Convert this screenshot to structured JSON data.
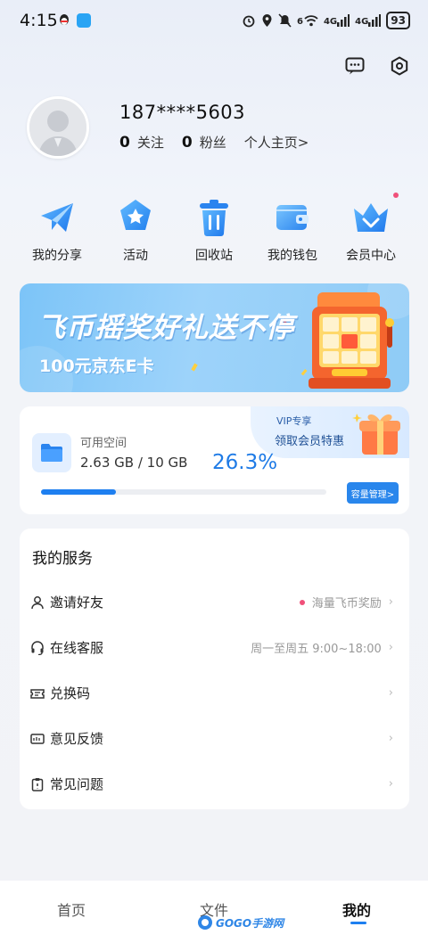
{
  "status_bar": {
    "time": "4:15",
    "signal_1": "4G",
    "signal_2": "4G",
    "wifi_badge": "6",
    "battery": "93"
  },
  "profile": {
    "phone": "187****5603",
    "following_count": "0",
    "following_label": "关注",
    "followers_count": "0",
    "followers_label": "粉丝",
    "home_link": "个人主页>"
  },
  "quick_actions": [
    {
      "label": "我的分享",
      "icon": "paper-plane-icon"
    },
    {
      "label": "活动",
      "icon": "star-badge-icon"
    },
    {
      "label": "回收站",
      "icon": "trash-icon"
    },
    {
      "label": "我的钱包",
      "icon": "wallet-icon"
    },
    {
      "label": "会员中心",
      "icon": "crown-icon"
    }
  ],
  "banner": {
    "title": "飞币摇奖好礼送不停",
    "subtitle": "100元京东E卡"
  },
  "storage": {
    "label": "可用空间",
    "usage": "2.63 GB / 10 GB",
    "percent_text": "26.3%",
    "fraction": 0.263,
    "vip_title": "VIP专享",
    "vip_subtitle": "领取会员特惠",
    "capacity_button": "容量管理>"
  },
  "services": {
    "title": "我的服务",
    "items": [
      {
        "label": "邀请好友",
        "right": "海量飞币奖励",
        "dot": true,
        "icon": "person-icon"
      },
      {
        "label": "在线客服",
        "right": "周一至周五 9:00~18:00",
        "dot": false,
        "icon": "headset-icon"
      },
      {
        "label": "兑换码",
        "right": "",
        "dot": false,
        "icon": "ticket-icon"
      },
      {
        "label": "意见反馈",
        "right": "",
        "dot": false,
        "icon": "feedback-icon"
      },
      {
        "label": "常见问题",
        "right": "",
        "dot": false,
        "icon": "clipboard-icon"
      }
    ]
  },
  "bottom_nav": {
    "items": [
      "首页",
      "文件",
      "我的"
    ],
    "active": "我的"
  },
  "watermark": {
    "text": "GOGO手游网"
  },
  "colors": {
    "accent": "#1e7ff0",
    "dot": "#f0507a"
  }
}
